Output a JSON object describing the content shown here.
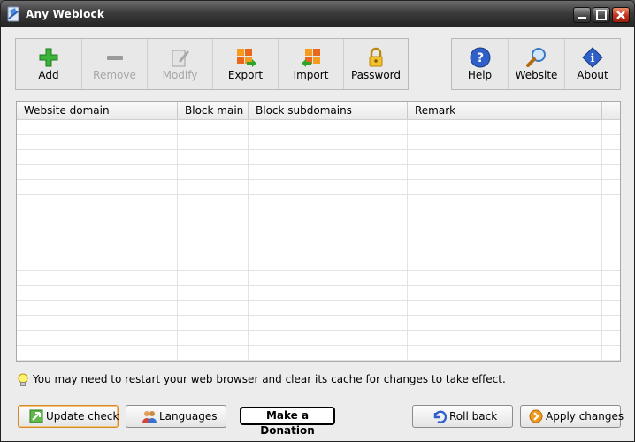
{
  "window": {
    "title": "Any Weblock"
  },
  "toolbar": {
    "left": [
      {
        "label": "Add",
        "icon": "add-icon",
        "enabled": true
      },
      {
        "label": "Remove",
        "icon": "remove-icon",
        "enabled": false
      },
      {
        "label": "Modify",
        "icon": "modify-icon",
        "enabled": false
      },
      {
        "label": "Export",
        "icon": "export-icon",
        "enabled": true
      },
      {
        "label": "Import",
        "icon": "import-icon",
        "enabled": true
      },
      {
        "label": "Password",
        "icon": "lock-icon",
        "enabled": true
      }
    ],
    "right": [
      {
        "label": "Help",
        "icon": "help-icon",
        "enabled": true
      },
      {
        "label": "Website",
        "icon": "magnifier-icon",
        "enabled": true
      },
      {
        "label": "About",
        "icon": "info-icon",
        "enabled": true
      }
    ]
  },
  "table": {
    "columns": [
      "Website domain",
      "Block main",
      "Block subdomains",
      "Remark"
    ],
    "rows": []
  },
  "hint": {
    "text": "You may need to restart your web browser and clear its cache for changes to take effect."
  },
  "buttons": {
    "update": "Update check",
    "languages": "Languages",
    "donate": "Make a Donation",
    "rollback": "Roll back",
    "apply": "Apply changes"
  },
  "colors": {
    "titlebar": "#3c3c3c",
    "accent": "#d38a2a",
    "add_green": "#2aa52a"
  }
}
